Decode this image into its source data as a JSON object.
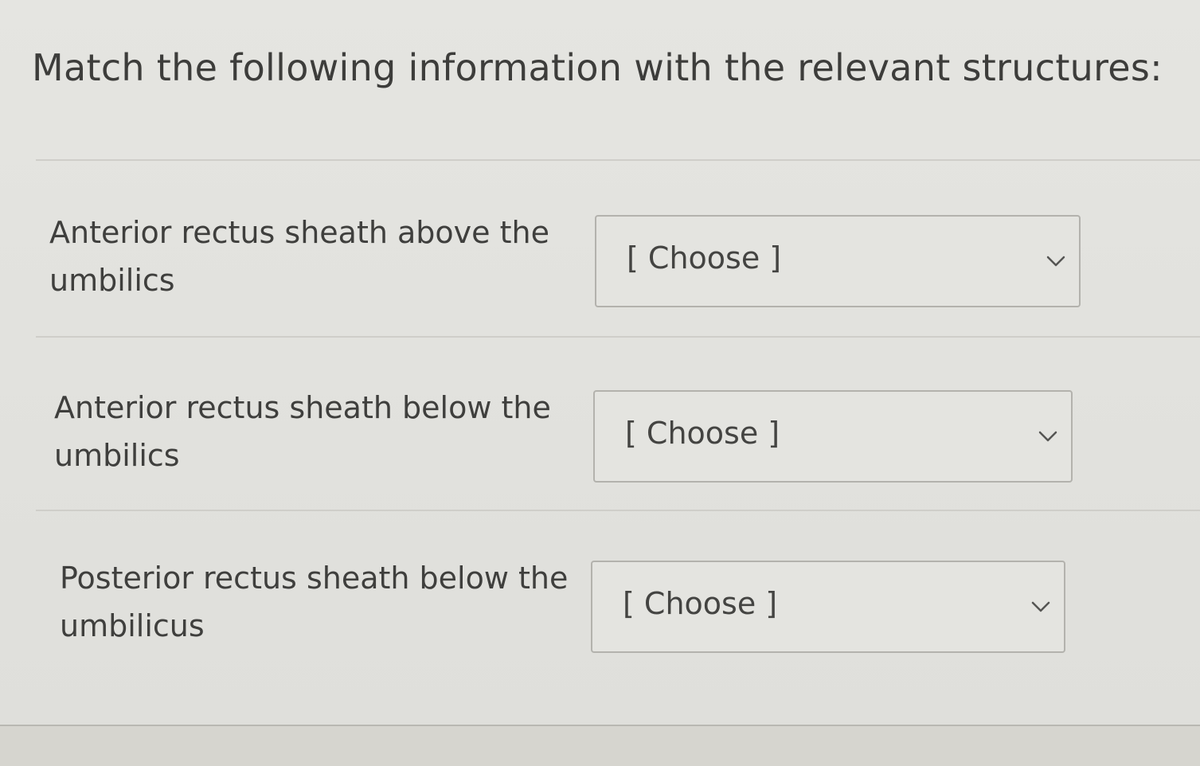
{
  "question": {
    "prompt": "Match the following information with the relevant structures:"
  },
  "rows": [
    {
      "label_line1": "Anterior rectus sheath above the",
      "label_line2": "umbilics",
      "selected": "[ Choose ]"
    },
    {
      "label_line1": "Anterior rectus sheath below the",
      "label_line2": "umbilics",
      "selected": "[ Choose ]"
    },
    {
      "label_line1": "Posterior rectus sheath below the",
      "label_line2": "umbilicus",
      "selected": "[ Choose ]"
    }
  ],
  "icons": {
    "dropdown": "chevron-down-icon"
  },
  "colors": {
    "background": "#e2e2de",
    "text": "#3f3f3d",
    "border": "#b3b2ad"
  }
}
